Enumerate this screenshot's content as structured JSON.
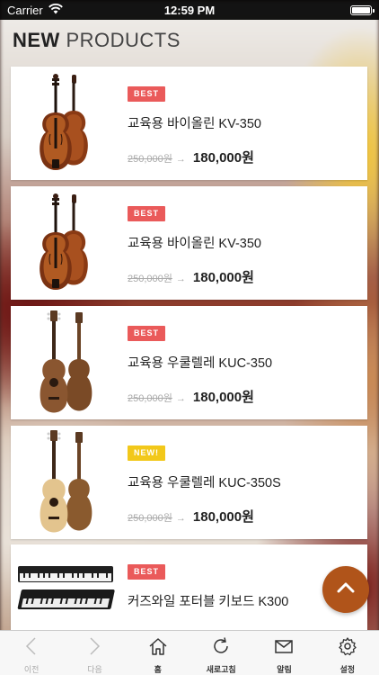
{
  "status_bar": {
    "carrier": "Carrier",
    "time": "12:59 PM"
  },
  "page_title": {
    "strong": "NEW",
    "light": "PRODUCTS"
  },
  "products": [
    {
      "badge": "BEST",
      "badge_type": "best",
      "name": "교육용 바이올린 KV-350",
      "old_price": "250,000원",
      "new_price": "180,000원",
      "image": "violin"
    },
    {
      "badge": "BEST",
      "badge_type": "best",
      "name": "교육용 바이올린 KV-350",
      "old_price": "250,000원",
      "new_price": "180,000원",
      "image": "violin"
    },
    {
      "badge": "BEST",
      "badge_type": "best",
      "name": "교육용 우쿨렐레 KUC-350",
      "old_price": "250,000원",
      "new_price": "180,000원",
      "image": "ukulele-dark"
    },
    {
      "badge": "NEW!",
      "badge_type": "new",
      "name": "교육용 우쿨렐레 KUC-350S",
      "old_price": "250,000원",
      "new_price": "180,000원",
      "image": "ukulele-light"
    },
    {
      "badge": "BEST",
      "badge_type": "best",
      "name": "커즈와일 포터블 키보드 K300",
      "old_price": "",
      "new_price": "",
      "image": "keyboard"
    }
  ],
  "fab": {
    "icon": "chevron-up-icon"
  },
  "tabbar": {
    "prev": "이전",
    "next": "다음",
    "home": "홈",
    "refresh": "새로고침",
    "notify": "알림",
    "settings": "설정"
  },
  "colors": {
    "best": "#ea5a5a",
    "new": "#f2c81a",
    "fab": "#b0541a"
  }
}
